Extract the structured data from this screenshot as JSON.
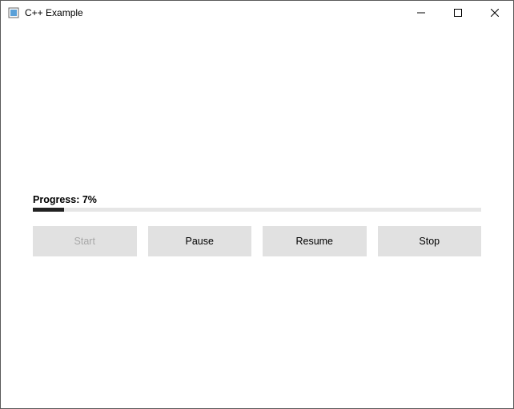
{
  "window": {
    "title": "C++ Example"
  },
  "progress": {
    "label_prefix": "Progress:",
    "percent": 7
  },
  "buttons": {
    "start": "Start",
    "pause": "Pause",
    "resume": "Resume",
    "stop": "Stop"
  }
}
